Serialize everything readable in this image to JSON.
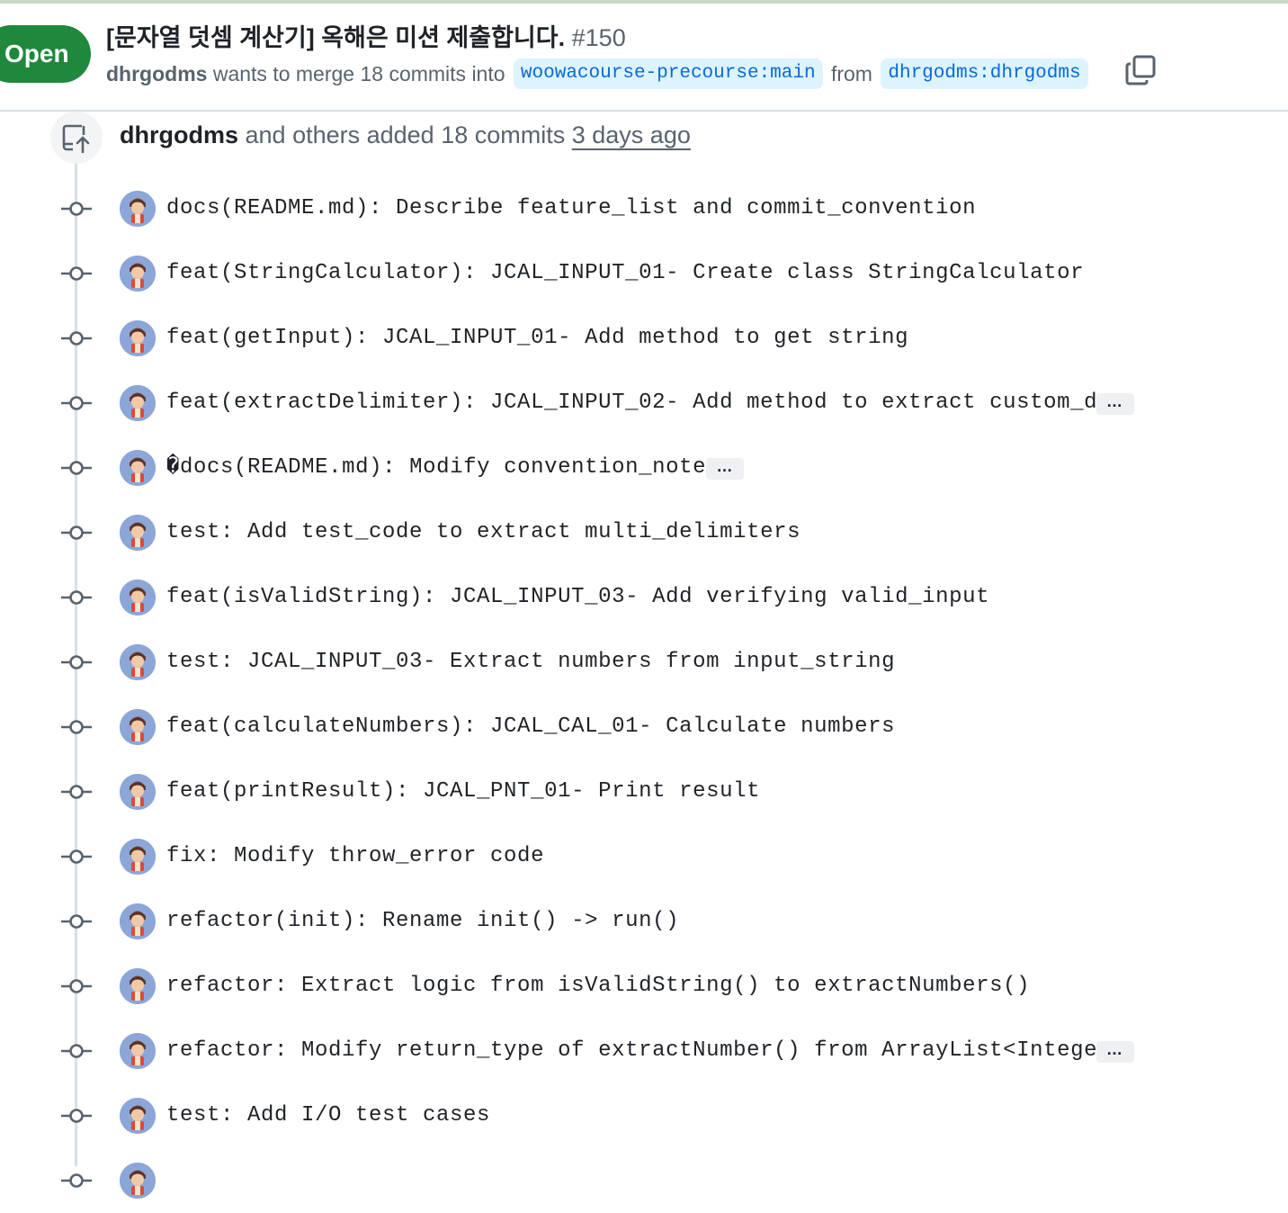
{
  "pr": {
    "state": "Open",
    "title": "[문자열 덧셈 계산기] 옥해은 미션 제출합니다.",
    "number": "#150",
    "author": "dhrgodms",
    "merge_text": "wants to merge 18 commits into",
    "base_branch": "woowacourse-precourse:main",
    "from_text": "from",
    "head_branch": "dhrgodms:dhrgodms"
  },
  "timeline": {
    "group_author": "dhrgodms",
    "group_text": "and others added 18 commits",
    "group_time": "3 days ago",
    "commits": [
      {
        "message": "docs(README.md): Describe feature_list and commit_convention",
        "truncated": false
      },
      {
        "message": "feat(StringCalculator): JCAL_INPUT_01- Create class StringCalculator",
        "truncated": false
      },
      {
        "message": "feat(getInput): JCAL_INPUT_01- Add method to get string",
        "truncated": false
      },
      {
        "message": "feat(extractDelimiter): JCAL_INPUT_02- Add method to extract custom_d…",
        "truncated": true
      },
      {
        "message": "�docs(README.md): Modify convention_note",
        "truncated": true
      },
      {
        "message": "test: Add test_code to extract multi_delimiters",
        "truncated": false
      },
      {
        "message": "feat(isValidString): JCAL_INPUT_03- Add verifying valid_input",
        "truncated": false
      },
      {
        "message": "test: JCAL_INPUT_03- Extract numbers from input_string",
        "truncated": false
      },
      {
        "message": "feat(calculateNumbers): JCAL_CAL_01- Calculate numbers",
        "truncated": false
      },
      {
        "message": "feat(printResult): JCAL_PNT_01- Print result",
        "truncated": false
      },
      {
        "message": "fix: Modify throw_error code",
        "truncated": false
      },
      {
        "message": "refactor(init): Rename init() -> run()",
        "truncated": false
      },
      {
        "message": "refactor: Extract logic from isValidString() to extractNumbers()",
        "truncated": false
      },
      {
        "message": "refactor: Modify return_type of extractNumber() from ArrayList<Intege…",
        "truncated": true
      },
      {
        "message": "test: Add I/O test cases",
        "truncated": false
      },
      {
        "message": "",
        "truncated": false
      }
    ]
  },
  "icons": {
    "copy": "copy-icon",
    "push": "repo-push-icon",
    "commit_node": "git-commit-icon",
    "expand": "ellipsis-icon"
  },
  "colors": {
    "open_green": "#1f883d",
    "branch_bg": "#ddf4ff",
    "branch_fg": "#0969da",
    "muted": "#59636e",
    "timeline": "#d8dee4"
  }
}
